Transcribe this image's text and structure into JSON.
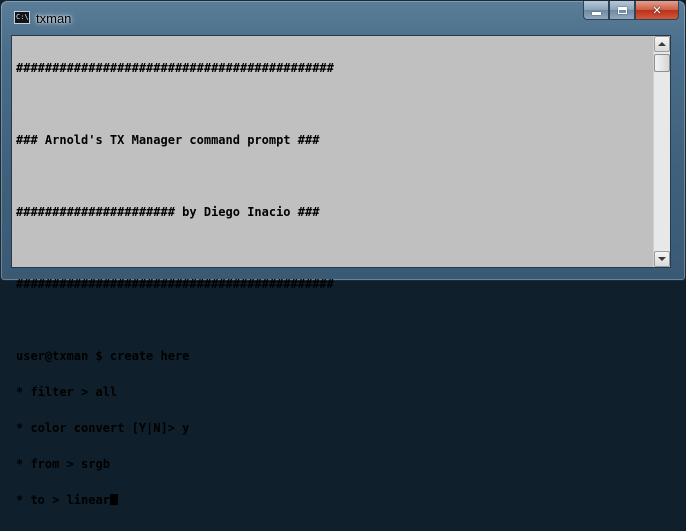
{
  "window": {
    "title": "txman",
    "icon_text": "C:\\",
    "icon": "console-icon",
    "controls": {
      "minimize": "minimize-icon",
      "maximize": "maximize-icon",
      "close_glyph": "✕"
    }
  },
  "console": {
    "lines": [
      "############################################",
      "",
      "### Arnold's TX Manager command prompt ###",
      "",
      "###################### by Diego Inacio ###",
      "",
      "############################################",
      "",
      "user@txman $ create here",
      "* filter > all",
      "* color convert [Y|N]> y",
      "* from > srgb",
      "* to > linear"
    ]
  },
  "colors": {
    "console_background": "#c0c0c0",
    "console_text": "#000000",
    "titlebar": "#4a6d89",
    "close_button": "#c7442a"
  }
}
